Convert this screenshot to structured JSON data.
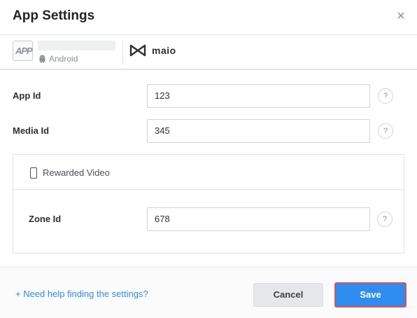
{
  "header": {
    "title": "App Settings",
    "close_symbol": "×"
  },
  "app": {
    "logo_text": "APP",
    "platform": "Android",
    "network_name": "maio"
  },
  "form": {
    "app_id": {
      "label": "App Id",
      "value": "123"
    },
    "media_id": {
      "label": "Media Id",
      "value": "345"
    },
    "help_symbol": "?"
  },
  "ad_unit": {
    "title": "Rewarded Video",
    "zone_id": {
      "label": "Zone Id",
      "value": "678"
    }
  },
  "footer": {
    "help_link": "+ Need help finding the settings?",
    "cancel_label": "Cancel",
    "save_label": "Save"
  },
  "icons": {
    "platform_icon": "android-icon",
    "network_icon": "maio-logo-icon",
    "ad_unit_icon": "phone-icon"
  },
  "colors": {
    "primary": "#2f8cf0",
    "link": "#2f8be0",
    "highlight_border": "#d9534f"
  }
}
